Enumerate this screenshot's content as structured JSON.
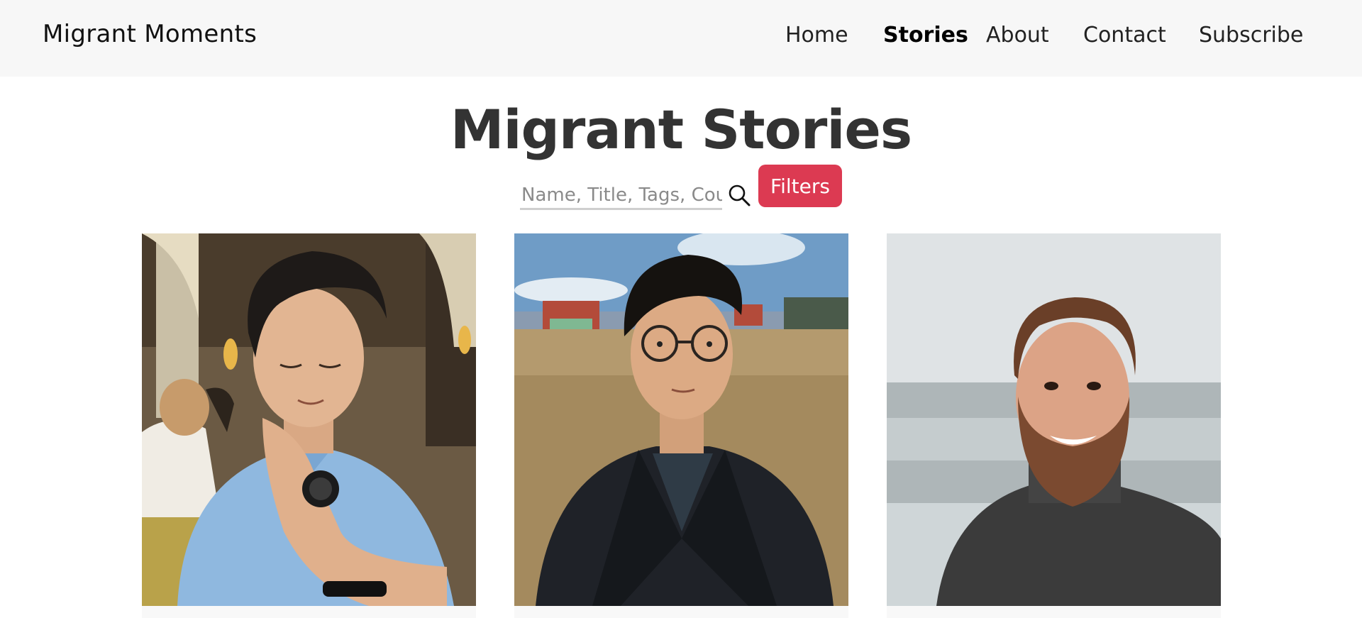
{
  "header": {
    "brand": "Migrant Moments",
    "nav": [
      {
        "label": "Home",
        "active": false
      },
      {
        "label": "Stories",
        "active": true
      },
      {
        "label": "About",
        "active": false
      },
      {
        "label": "Contact",
        "active": false
      },
      {
        "label": "Subscribe",
        "active": false
      }
    ]
  },
  "main": {
    "title": "Migrant Stories",
    "search": {
      "placeholder": "Name, Title, Tags, Country",
      "value": ""
    },
    "filters_label": "Filters",
    "icons": {
      "search": "search-icon"
    }
  },
  "colors": {
    "navbar_bg": "#f7f7f7",
    "accent": "#dc3a52",
    "title": "#333333"
  },
  "cards": [
    {
      "photo": "portrait-man-blue-shirt-watch"
    },
    {
      "photo": "portrait-man-glasses-outdoors"
    },
    {
      "photo": "portrait-man-beard-seaside"
    }
  ]
}
